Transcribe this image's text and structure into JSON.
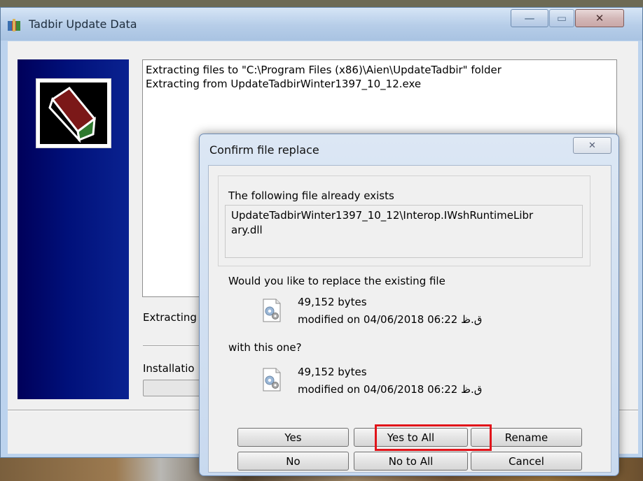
{
  "window": {
    "title": "Tadbir Update Data",
    "minimize_glyph": "—",
    "maximize_glyph": "▭",
    "close_glyph": "✕"
  },
  "log": {
    "lines": [
      "Extracting files to \"C:\\Program Files (x86)\\Aien\\UpdateTadbir\" folder",
      "Extracting from UpdateTadbirWinter1397_10_12.exe"
    ]
  },
  "status": {
    "extracting_label": "Extracting",
    "installation_label": "Installatio"
  },
  "dialog": {
    "title": "Confirm file replace",
    "close_glyph": "✕",
    "exists_label": "The following file already exists",
    "file_path_line1": "UpdateTadbirWinter1397_10_12\\Interop.IWshRuntimeLibr",
    "file_path_line2": "ary.dll",
    "question_replace": "Would you like to replace the existing file",
    "existing_file": {
      "size": "49,152 bytes",
      "modified": "modified on 04/06/2018 06:22 ق.ظ"
    },
    "question_with": "with this one?",
    "new_file": {
      "size": "49,152 bytes",
      "modified": "modified on 04/06/2018 06:22 ق.ظ"
    },
    "buttons": {
      "yes": "Yes",
      "yes_to_all": "Yes to All",
      "rename": "Rename",
      "no": "No",
      "no_to_all": "No to All",
      "cancel": "Cancel"
    }
  },
  "colors": {
    "highlight": "#e1141a",
    "sidebar": "#00107a"
  },
  "icons": {
    "app": "archive-icon",
    "logo": "box-logo",
    "file": "dll-file-icon"
  }
}
